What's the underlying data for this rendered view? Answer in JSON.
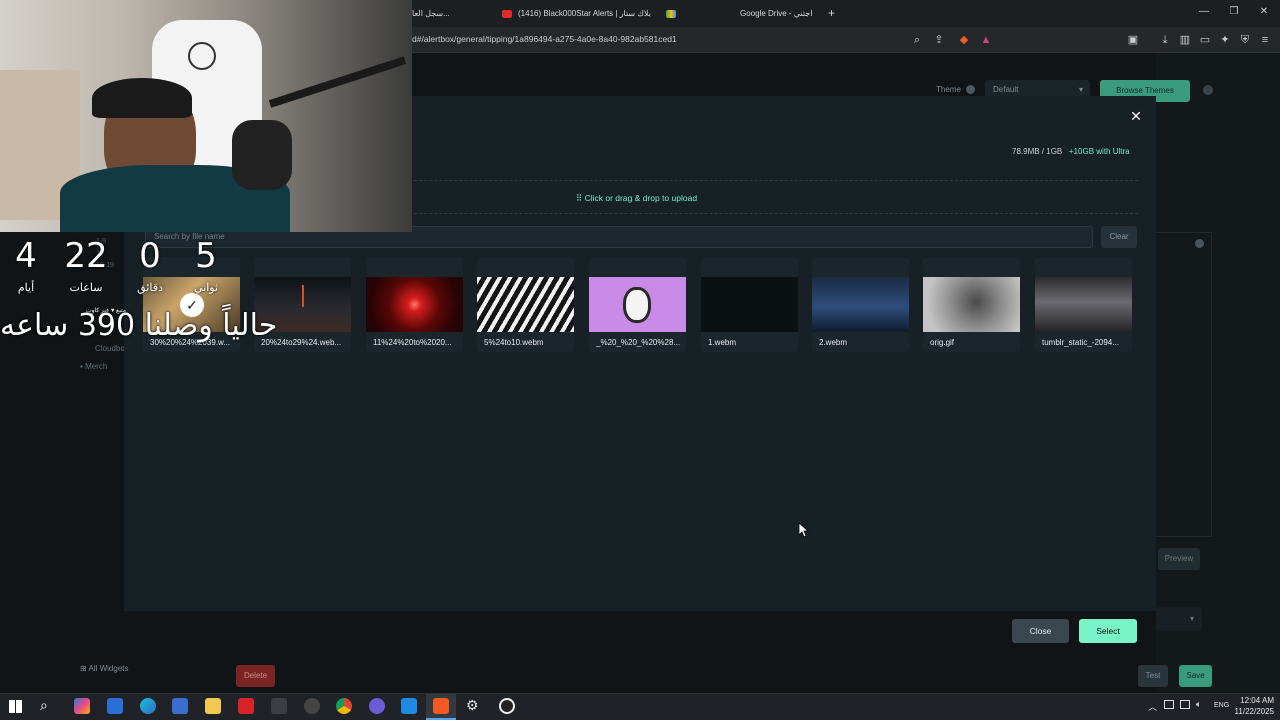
{
  "browser": {
    "tabs": [
      {
        "label": "سجل العا..."
      },
      {
        "label": "(1416) Black000Star Alerts | بلاك ستار"
      },
      {
        "label": ""
      },
      {
        "label": "Google Drive - اجتني"
      }
    ],
    "new_tab": "+",
    "url": "d#/alertbox/general/tipping/1a896494-a275-4a0e-8a40-982ab581ced1"
  },
  "page": {
    "theme_label": "Theme",
    "theme_value": "Default",
    "browse_themes": "Browse Themes",
    "preview": "Preview",
    "test": "Test",
    "save": "Save",
    "delete": "Delete",
    "all_widgets": "All Widgets",
    "sidebar_items": [
      "Cloudbo",
      "Merch"
    ],
    "sidebar_dates": [
      "1-9",
      "19",
      "10-19"
    ]
  },
  "modal": {
    "storage_used": "78.9MB / 1GB",
    "storage_upgrade": "+10GB with Ultra",
    "upload_text": "Click or drag & drop to upload",
    "search_placeholder": "Search by file name",
    "clear_label": "Clear",
    "files": [
      {
        "name": "30%20%24%2039.w...",
        "selected": true
      },
      {
        "name": "20%24to29%24.web..."
      },
      {
        "name": "11%24%20to%2020..."
      },
      {
        "name": "5%24to10.webm"
      },
      {
        "name": "_%20_%20_%20%28..."
      },
      {
        "name": "1.webm"
      },
      {
        "name": "2.webm"
      },
      {
        "name": "orig.gif"
      },
      {
        "name": "tumblr_static_-2094..."
      }
    ],
    "close_label": "Close",
    "select_label": "Select"
  },
  "overlay": {
    "timer": [
      {
        "value": "4",
        "unit": "أيام"
      },
      {
        "value": "22",
        "unit": "ساعات"
      },
      {
        "value": "0",
        "unit": "دقائق"
      },
      {
        "value": "5",
        "unit": "ثواني"
      }
    ],
    "goal_text": "حالياً وصلنا 390 ساعه",
    "sub_text": "متبع ♥ غير كاوت"
  },
  "taskbar": {
    "lang": "ENG",
    "time": "12:04 AM",
    "date": "11/22/2025"
  }
}
